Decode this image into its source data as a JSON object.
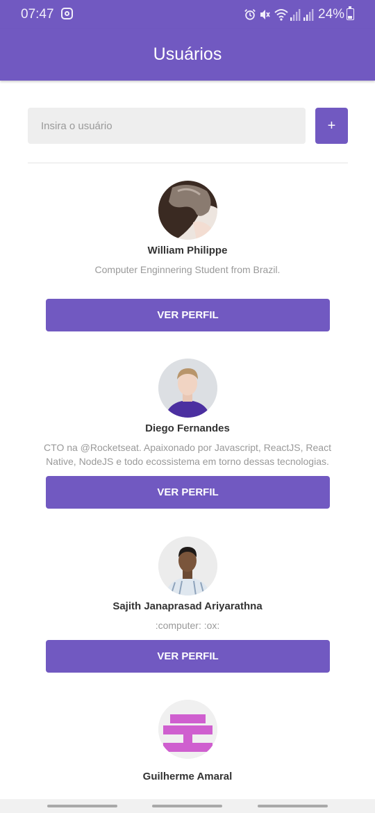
{
  "status_bar": {
    "time": "07:47",
    "battery": "24%",
    "icons": [
      "instagram-icon",
      "alarm-icon",
      "mute-icon",
      "wifi-icon",
      "signal-icon",
      "signal-icon",
      "battery-icon"
    ]
  },
  "header": {
    "title": "Usuários"
  },
  "search": {
    "placeholder": "Insira o usuário",
    "value": "",
    "add_label": "+"
  },
  "users": [
    {
      "name": "William Philippe",
      "bio": "Computer Enginnering Student from Brazil.",
      "button_label": "VER PERFIL"
    },
    {
      "name": "Diego Fernandes",
      "bio": "CTO na @Rocketseat. Apaixonado por Javascript, ReactJS, React Native, NodeJS e todo ecossistema em torno dessas tecnologias.",
      "button_label": "VER PERFIL"
    },
    {
      "name": "Sajith Janaprasad Ariyarathna",
      "bio": ":computer: :ox:",
      "button_label": "VER PERFIL"
    },
    {
      "name": "Guilherme Amaral",
      "bio": "",
      "button_label": ""
    }
  ],
  "colors": {
    "primary": "#7159c1",
    "input_background": "#eeeeee",
    "text_dark": "#333333",
    "text_muted": "#999999"
  }
}
